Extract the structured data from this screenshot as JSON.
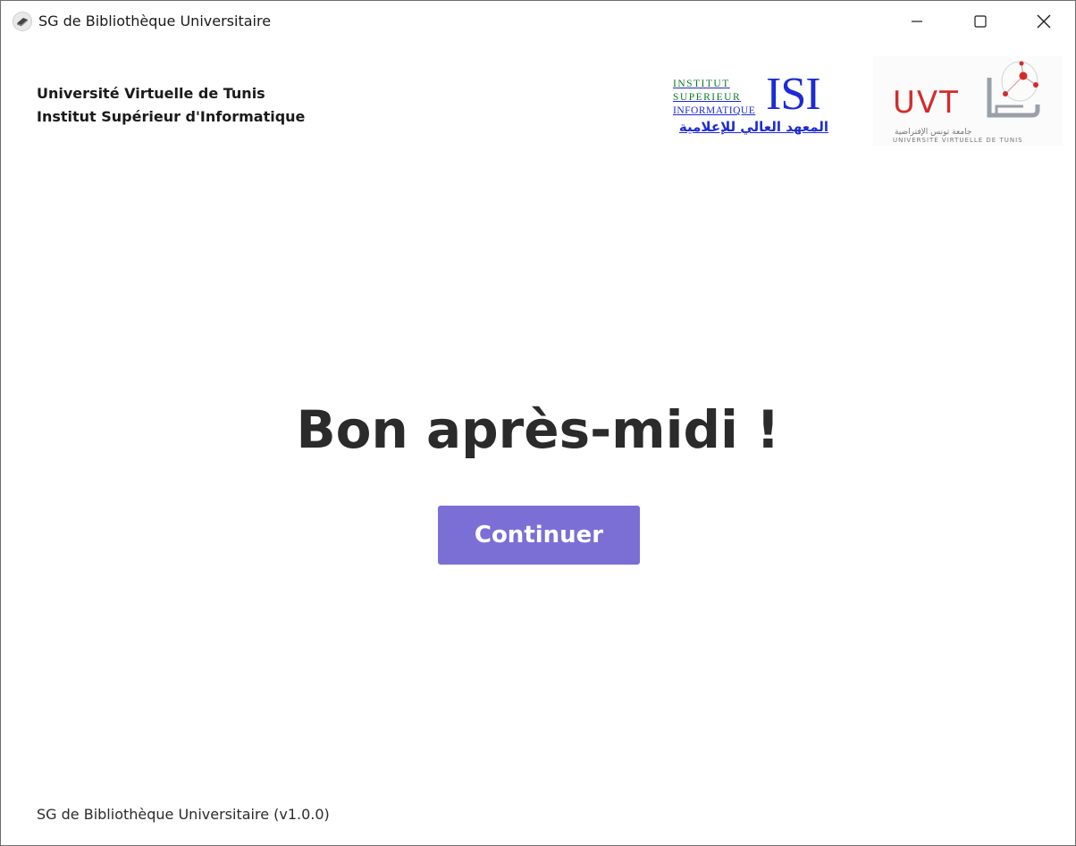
{
  "window": {
    "title": "SG de Bibliothèque Universitaire",
    "app_icon": "book-icon",
    "controls": {
      "minimize_icon": "minimize-icon",
      "maximize_icon": "maximize-icon",
      "close_icon": "close-icon"
    }
  },
  "header": {
    "university": "Université Virtuelle de Tunis",
    "institute": "Institut Supérieur d'Informatique",
    "isi_logo": {
      "line1": "INSTITUT",
      "line2": "SUPERIEUR",
      "line3": "INFORMATIQUE",
      "acronym": "ISI",
      "arabic": "المعهد العالي للإعلامية"
    },
    "uvt_logo": {
      "acronym": "UVT",
      "arabic": "جامعة تونس الإفتراضية",
      "subtitle": "UNIVERSITÉ VIRTUELLE DE TUNIS"
    }
  },
  "main": {
    "greeting": "Bon après-midi !",
    "continue_label": "Continuer"
  },
  "footer": {
    "version_text": "SG de Bibliothèque Universitaire (v1.0.0)"
  },
  "colors": {
    "accent": "#7b6fd6",
    "isi_blue": "#1d2bd6",
    "isi_green": "#0a7a20",
    "uvt_red": "#d42b2b"
  }
}
